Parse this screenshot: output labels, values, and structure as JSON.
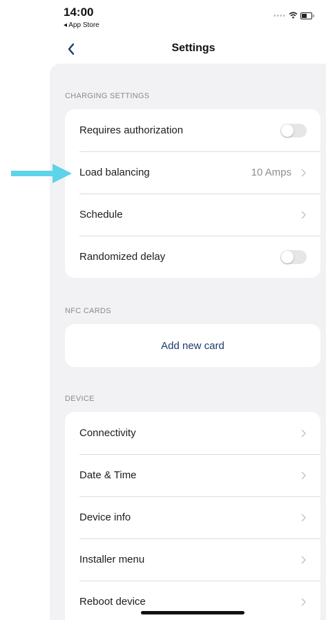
{
  "status_bar": {
    "time": "14:00",
    "back_app": "◂ App Store"
  },
  "nav": {
    "title": "Settings"
  },
  "sections": {
    "charging": {
      "header": "CHARGING SETTINGS",
      "rows": [
        {
          "label": "Requires authorization",
          "control": "toggle",
          "on": false
        },
        {
          "label": "Load balancing",
          "value": "10 Amps",
          "control": "chevron"
        },
        {
          "label": "Schedule",
          "control": "chevron"
        },
        {
          "label": "Randomized delay",
          "control": "toggle",
          "on": false
        }
      ]
    },
    "nfc": {
      "header": "NFC CARDS",
      "add_button": "Add new card"
    },
    "device": {
      "header": "DEVICE",
      "rows": [
        {
          "label": "Connectivity"
        },
        {
          "label": "Date & Time"
        },
        {
          "label": "Device info"
        },
        {
          "label": "Installer menu"
        },
        {
          "label": "Reboot device"
        }
      ]
    }
  },
  "colors": {
    "accent_arrow": "#5ed3ea",
    "link": "#1b3a6b",
    "group_background": "#f2f2f4"
  }
}
